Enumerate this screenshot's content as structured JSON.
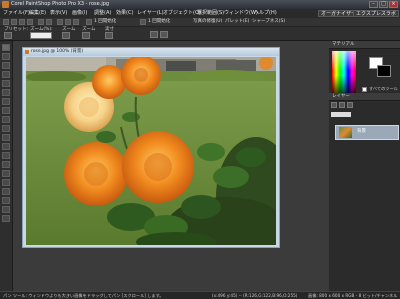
{
  "window": {
    "title": "Corel PaintShop Photo Pro X3 - rose.jpg",
    "min_glyph": "–",
    "max_glyph": "□",
    "close_glyph": "×"
  },
  "menu": {
    "items": [
      "ファイル(F)",
      "編集(E)",
      "表示(V)",
      "画像(I)",
      "調整(A)",
      "効果(C)",
      "レイヤー(L)",
      "オブジェクト(O)",
      "選択範囲(S)",
      "ウィンドウ(W)",
      "ヘルプ(H)"
    ]
  },
  "workspace_tabs": [
    "オーガナイザー",
    "エクスプレスラボ"
  ],
  "toolbar": {
    "labels": [
      "1 回開始化",
      "1 回開始化",
      "写真の修復(U)",
      "パレット(E)",
      "シャープネス(S)"
    ]
  },
  "options_bar": {
    "labels": [
      "プリセット:",
      "ズーム(%):",
      "ズーム",
      "ズーム",
      "実寸"
    ]
  },
  "document": {
    "title": "rose.jpg @ 100% (背景)"
  },
  "panels": {
    "materials": {
      "title": "マテリアル"
    },
    "layers": {
      "title": "レイヤー",
      "layer_name": "背景"
    },
    "all_tools_label": "すべてのツール"
  },
  "colors": {
    "foreground": "#ffffff",
    "background": "#000000",
    "accent": "#c87a2a"
  },
  "statusbar": {
    "hint": "パン ツール: ウィンドウよりも大きい画像をドラッグしてパン [スクロール] します。",
    "coords": "(x:496 y:45) -- (R:126,G:122,B:96,O:255)",
    "image_info": "画像: 800 x 600 x RGB - 8 ビット/チャンネル"
  }
}
